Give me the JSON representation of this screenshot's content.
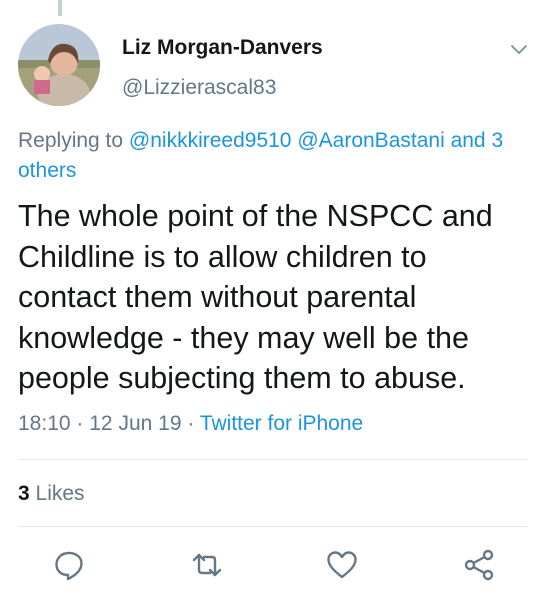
{
  "tweet": {
    "author_name": "Liz Morgan-Danvers",
    "author_handle": "@Lizzierascal83",
    "replying_prefix": "Replying to",
    "replying_to_1": "@nikkkireed9510",
    "replying_to_2": "@AaronBastani",
    "replying_and": "and",
    "replying_others": "3 others",
    "text": "The whole point of the NSPCC and Childline is to allow children to contact them without parental knowledge - they may well be the people subjecting them to abuse.",
    "time": "18:10",
    "date": "12 Jun 19",
    "separator": "·",
    "source": "Twitter for iPhone",
    "likes_count": "3",
    "likes_label": "Likes"
  },
  "icons": {
    "caret": "chevron-down-icon",
    "reply": "reply-icon",
    "retweet": "retweet-icon",
    "like": "heart-icon",
    "share": "share-icon"
  },
  "colors": {
    "link": "#1b95e0",
    "secondary_text": "#657786",
    "divider": "#e1e8ed"
  }
}
